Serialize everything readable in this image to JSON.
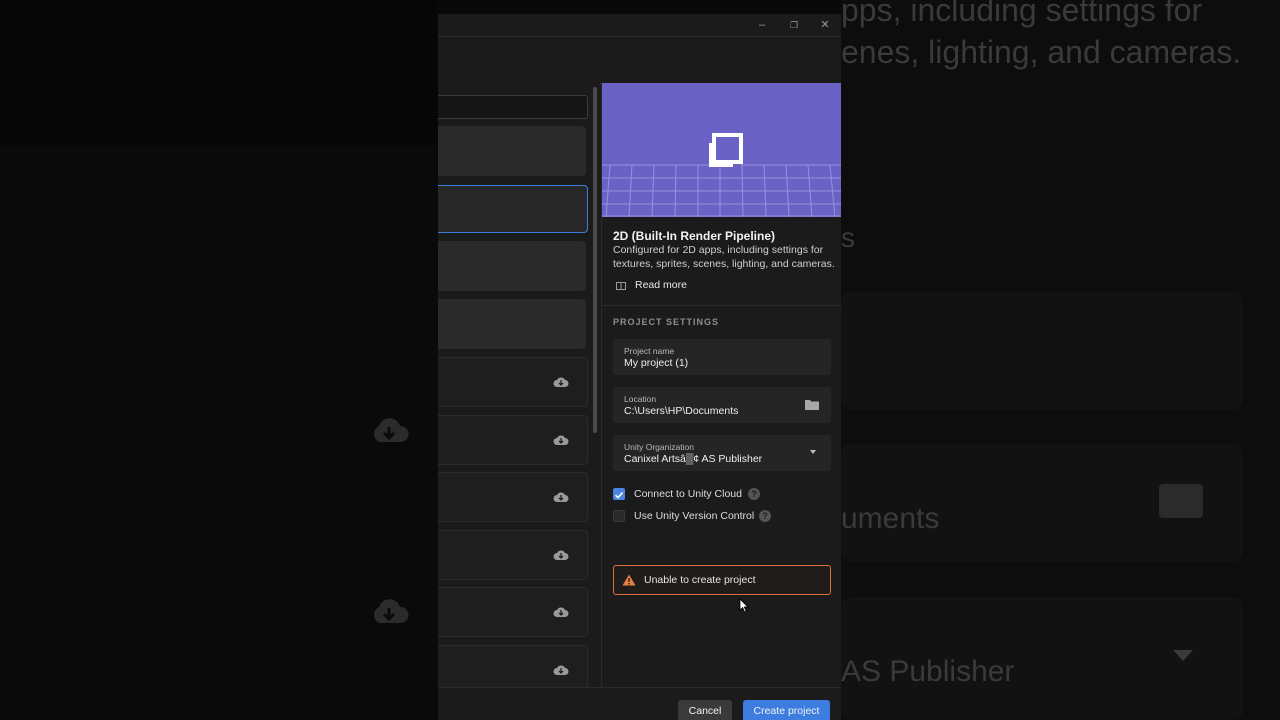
{
  "background": {
    "right_text_line1": "pps, including settings for",
    "right_text_line2": "enes, lighting, and cameras.",
    "right_text_s": "s",
    "right_text_documents": "uments",
    "right_text_publisher": "AS Publisher"
  },
  "template": {
    "title": "2D (Built-In Render Pipeline)",
    "description": "Configured for 2D apps, including settings for textures, sprites, scenes, lighting, and cameras.",
    "read_more": "Read more",
    "hero_color": "#6b62c6"
  },
  "settings": {
    "section_title": "PROJECT SETTINGS",
    "project_name_label": "Project name",
    "project_name_value": "My project (1)",
    "location_label": "Location",
    "location_value": "C:\\Users\\HP\\Documents",
    "org_label": "Unity Organization",
    "org_value": "Canixel Artsâ▒¢ AS Publisher",
    "connect_cloud_label": "Connect to Unity Cloud",
    "connect_cloud_checked": true,
    "version_control_label": "Use Unity Version Control",
    "version_control_checked": false,
    "help_glyph": "?"
  },
  "error": {
    "message": "Unable to create project",
    "color": "#d9733a"
  },
  "footer": {
    "cancel_label": "Cancel",
    "create_label": "Create project",
    "accent": "#3d7de0"
  },
  "window": {
    "minimize_glyph": "–",
    "maximize_glyph": "❐",
    "close_glyph": "✕"
  }
}
